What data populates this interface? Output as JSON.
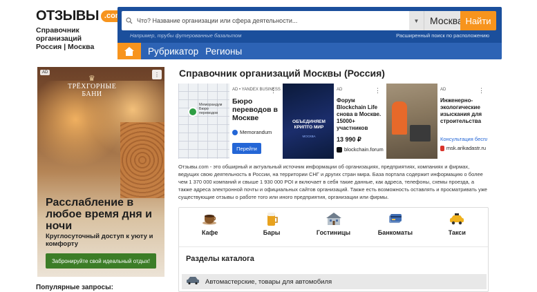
{
  "header": {
    "logo_text": "ОТЗЫВЫ",
    "logo_suffix": ".com",
    "tagline_line1": "Справочник организаций",
    "tagline_line2": "Россия | Москва"
  },
  "search": {
    "placeholder": "Что? Название организации или сфера деятельности...",
    "city": "Москва",
    "button": "Найти",
    "hint": "Например, трубы футерованные базальтом",
    "advanced": "Расширенный поиск по расположению"
  },
  "nav": {
    "items": [
      "Рубрикатор",
      "Регионы"
    ]
  },
  "left_ad": {
    "badge": "AD",
    "brand": "ТРЁХГОРНЫЕ БАНИ",
    "headline": "Расслабление в любое время дня и ночи",
    "sub": "Круглосуточный доступ к уюту и комфорту",
    "cta": "Забронируйте свой идеальный отдых!"
  },
  "popular": {
    "title": "Популярные запросы:"
  },
  "main": {
    "title": "Справочник организаций Москвы (Россия)"
  },
  "ad_cards": [
    {
      "meta": "AD • YANDEX BUSINESS",
      "title": "Бюро переводов в Москве",
      "brand": "Memorandum",
      "cta": "Перейти",
      "map_label": "Меморандум Бюро переводов"
    },
    {
      "meta": "AD",
      "title": "Форум Blockchain Life снова в Москве. 15000+ участников",
      "price": "13 990 ₽",
      "brand": "blockchain.forum",
      "thumb_text": "ОБЪЕДИНЯЕМ КРИПТО МИР",
      "thumb_sub": "МОСКВА"
    },
    {
      "meta": "AD",
      "title": "Инженерно-экологические изыскания для строительства",
      "price": "Консультация бесплатно!",
      "brand": "msk.arikadastr.ru"
    }
  ],
  "about": "Отзывы.com - это обширный и актуальный источник информации об организациях, предприятиях, компаниях и фирмах, ведущих свою деятельность в России, на территории СНГ и других стран мира. База портала содержит информацию о более чем 1 370 000 компаний и свыше 1 930 000 POI и включает в себя такие данные, как адреса, телефоны, схемы проезда, а также адреса электронной почты и официальных сайтов организаций. Также есть возможность оставлять и просматривать уже существующие отзывы о работе того или иного предприятия, организации или фирмы.",
  "quick": [
    {
      "label": "Кафе",
      "icon": "coffee-cup-icon"
    },
    {
      "label": "Бары",
      "icon": "beer-mug-icon"
    },
    {
      "label": "Гостиницы",
      "icon": "hotel-icon"
    },
    {
      "label": "Банкоматы",
      "icon": "atm-card-icon"
    },
    {
      "label": "Такси",
      "icon": "taxi-icon"
    }
  ],
  "catalog": {
    "title": "Разделы каталога",
    "first_section": "Автомастерские, товары для автомобиля"
  },
  "colors": {
    "panel": "#1b4f9c",
    "nav": "#2d63b5",
    "accent": "#f7941d"
  }
}
